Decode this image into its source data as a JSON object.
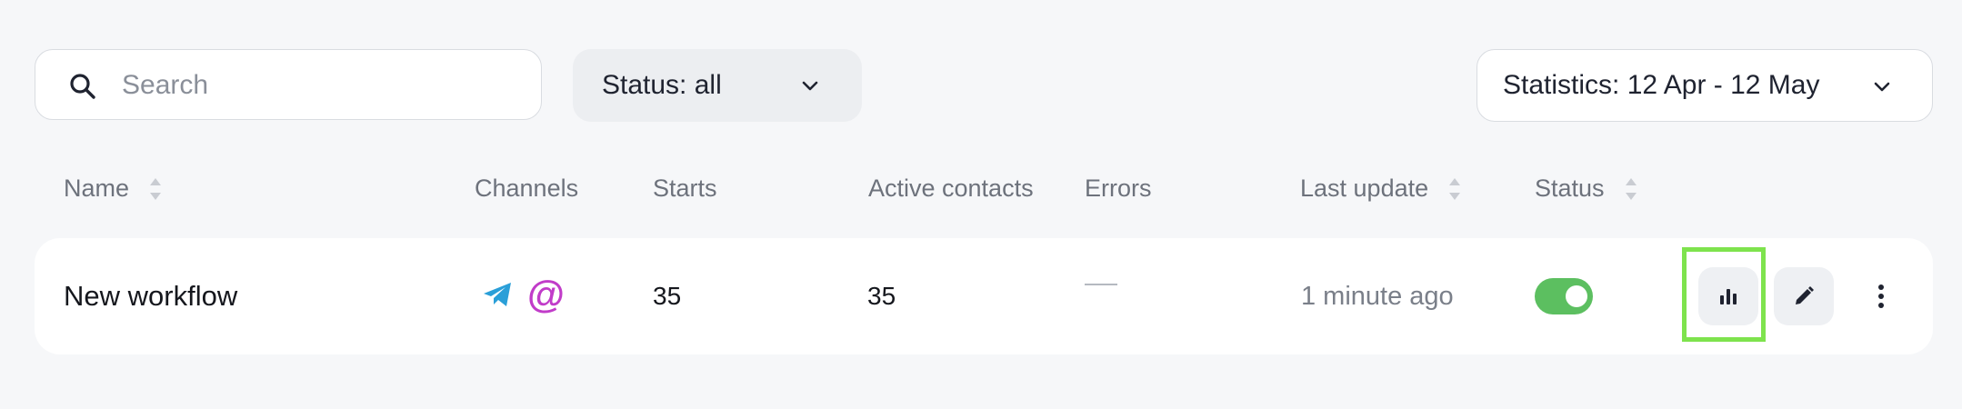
{
  "toolbar": {
    "search_placeholder": "Search",
    "status_filter_label": "Status: all",
    "statistics_filter_label": "Statistics: 12 Apr - 12 May"
  },
  "table": {
    "columns": [
      "Name",
      "Channels",
      "Starts",
      "Active contacts",
      "Errors",
      "Last update",
      "Status"
    ],
    "sortable_columns": [
      "Name",
      "Last update",
      "Status"
    ],
    "rows": [
      {
        "name": "New workflow",
        "channels": [
          "telegram-icon",
          "email-at-icon"
        ],
        "channel_at_symbol": "@",
        "starts": "35",
        "active_contacts": "35",
        "errors": "—",
        "last_update": "1 minute ago",
        "status_enabled": true
      }
    ]
  },
  "colors": {
    "background": "#f6f7f9",
    "toggle_on": "#5cbf60",
    "telegram": "#2a9fd8",
    "email_at": "#c13cc9",
    "highlight": "#7ee34d"
  }
}
